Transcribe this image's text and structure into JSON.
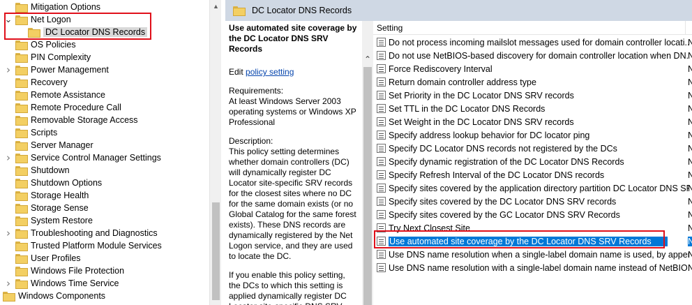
{
  "tree": {
    "items": [
      {
        "label": "Mitigation Options",
        "chevron": ""
      },
      {
        "label": "Net Logon",
        "chevron": "v"
      },
      {
        "label": "DC Locator DNS Records",
        "chevron": "",
        "child": true,
        "selected": true
      },
      {
        "label": "OS Policies",
        "chevron": ""
      },
      {
        "label": "PIN Complexity",
        "chevron": ""
      },
      {
        "label": "Power Management",
        "chevron": ">"
      },
      {
        "label": "Recovery",
        "chevron": ""
      },
      {
        "label": "Remote Assistance",
        "chevron": ""
      },
      {
        "label": "Remote Procedure Call",
        "chevron": ""
      },
      {
        "label": "Removable Storage Access",
        "chevron": ""
      },
      {
        "label": "Scripts",
        "chevron": ""
      },
      {
        "label": "Server Manager",
        "chevron": ""
      },
      {
        "label": "Service Control Manager Settings",
        "chevron": ">"
      },
      {
        "label": "Shutdown",
        "chevron": ""
      },
      {
        "label": "Shutdown Options",
        "chevron": ""
      },
      {
        "label": "Storage Health",
        "chevron": ""
      },
      {
        "label": "Storage Sense",
        "chevron": ""
      },
      {
        "label": "System Restore",
        "chevron": ""
      },
      {
        "label": "Troubleshooting and Diagnostics",
        "chevron": ">"
      },
      {
        "label": "Trusted Platform Module Services",
        "chevron": ""
      },
      {
        "label": "User Profiles",
        "chevron": ""
      },
      {
        "label": "Windows File Protection",
        "chevron": ""
      },
      {
        "label": "Windows Time Service",
        "chevron": ">"
      },
      {
        "label": "Windows Components",
        "chevron": "",
        "root": true
      }
    ]
  },
  "header": {
    "title": "DC Locator DNS Records"
  },
  "description": {
    "heading": "Use automated site coverage by the DC Locator DNS SRV Records",
    "edit_prefix": "Edit ",
    "edit_link": "policy setting ",
    "requirements_label": "Requirements:",
    "requirements_text": "At least Windows Server 2003 operating systems or Windows XP Professional",
    "description_label": "Description:",
    "description_text": "This policy setting determines whether domain controllers (DC) will dynamically register DC Locator site-specific SRV records for the closest sites where no DC for the same domain exists (or no Global Catalog for the same forest exists). These DNS records are dynamically registered by the Net Logon service, and they are used to locate the DC.",
    "enable_text": "If you enable this policy setting, the DCs to which this setting is applied dynamically register DC Locator site-specific DNS SRV"
  },
  "list": {
    "column_setting": "Setting",
    "rows": [
      {
        "name": "Do not process incoming mailslot messages used for domain controller locati...",
        "state": "N"
      },
      {
        "name": "Do not use NetBIOS-based discovery for domain controller location when DN...",
        "state": "N"
      },
      {
        "name": "Force Rediscovery Interval",
        "state": "N"
      },
      {
        "name": "Return domain controller address type",
        "state": "N"
      },
      {
        "name": "Set Priority in the DC Locator DNS SRV records",
        "state": "N"
      },
      {
        "name": "Set TTL  in the DC Locator DNS Records",
        "state": "N"
      },
      {
        "name": "Set Weight in the DC Locator DNS SRV records",
        "state": "N"
      },
      {
        "name": "Specify address lookup behavior for DC locator ping",
        "state": "N"
      },
      {
        "name": "Specify DC Locator DNS records not registered by the DCs",
        "state": "N"
      },
      {
        "name": "Specify dynamic registration of the DC Locator DNS Records",
        "state": "N"
      },
      {
        "name": "Specify Refresh Interval of the DC Locator DNS records",
        "state": "N"
      },
      {
        "name": "Specify sites covered by the application directory partition DC Locator DNS SR...",
        "state": "N"
      },
      {
        "name": "Specify sites covered by the DC Locator DNS SRV records",
        "state": "N"
      },
      {
        "name": "Specify sites covered by the GC Locator DNS SRV Records",
        "state": "N"
      },
      {
        "name": "Try Next Closest Site",
        "state": "N"
      },
      {
        "name": "Use automated site coverage by the DC Locator DNS SRV Records",
        "state": "N",
        "selected": true
      },
      {
        "name": "Use DNS name resolution when a single-label domain name is used, by appen...",
        "state": "N"
      },
      {
        "name": "Use DNS name resolution with a single-label domain name instead of NetBIO...",
        "state": "N"
      }
    ]
  },
  "colors": {
    "selection": "#0078d7",
    "highlight_box": "#e0101a",
    "header_bar": "#cfd8e4"
  }
}
